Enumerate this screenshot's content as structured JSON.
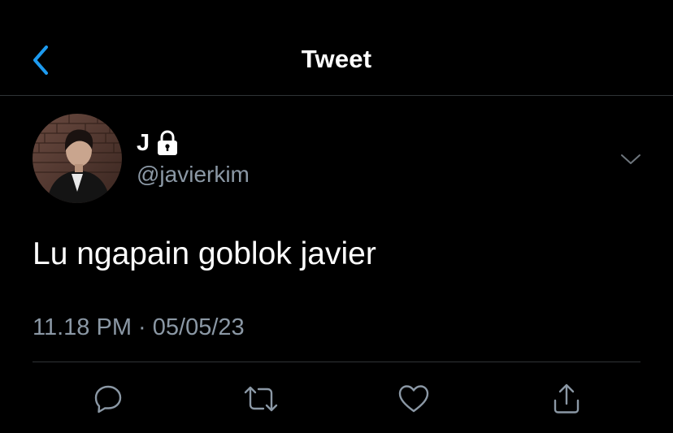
{
  "header": {
    "title": "Tweet",
    "back_icon": "chevron-left-icon",
    "accent_color": "#1d9bf0"
  },
  "tweet": {
    "author": {
      "display_name": "J",
      "protected": true,
      "lock_icon": "lock-icon",
      "handle": "@javierkim"
    },
    "text": "Lu ngapain goblok javier",
    "time": "11.18 PM",
    "separator": "·",
    "date": "05/05/23"
  },
  "actions": [
    {
      "name": "reply",
      "icon": "reply-icon"
    },
    {
      "name": "retweet",
      "icon": "retweet-icon"
    },
    {
      "name": "like",
      "icon": "heart-icon"
    },
    {
      "name": "share",
      "icon": "share-icon"
    }
  ],
  "colors": {
    "background": "#000000",
    "text": "#ffffff",
    "secondary_text": "#8b98a5",
    "divider": "#2f3336"
  }
}
